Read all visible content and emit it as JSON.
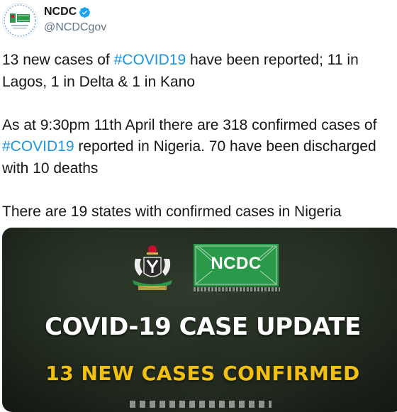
{
  "tweet": {
    "author": {
      "display_name": "NCDC",
      "handle": "@NCDCgov",
      "verified_icon": "verified-badge-icon",
      "avatar_icon": "ncdc-avatar"
    },
    "paragraphs": [
      {
        "segments": [
          {
            "text": "13 new cases of ",
            "type": "text"
          },
          {
            "text": "#COVID19",
            "type": "hashtag"
          },
          {
            "text": " have been reported; 11 in Lagos, 1 in Delta & 1 in Kano",
            "type": "text"
          }
        ]
      },
      {
        "segments": [
          {
            "text": "As at 9:30pm 11th April there are 318 confirmed cases of ",
            "type": "text"
          },
          {
            "text": "#COVID19",
            "type": "hashtag"
          },
          {
            "text": " reported in Nigeria. 70 have been discharged with 10 deaths",
            "type": "text"
          }
        ]
      },
      {
        "segments": [
          {
            "text": "There are 19 states with confirmed cases in Nigeria",
            "type": "text"
          }
        ]
      }
    ],
    "media": {
      "logo_text": "NCDC",
      "title": "COVID-19 CASE UPDATE",
      "subtitle": "13 NEW CASES CONFIRMED"
    }
  },
  "colors": {
    "hashtag": "#1b95e0",
    "text": "#14171a",
    "muted": "#657786",
    "verified": "#1da1f2",
    "media_subtitle": "#f2c010",
    "ncdc_green": "#2a9a4a"
  }
}
